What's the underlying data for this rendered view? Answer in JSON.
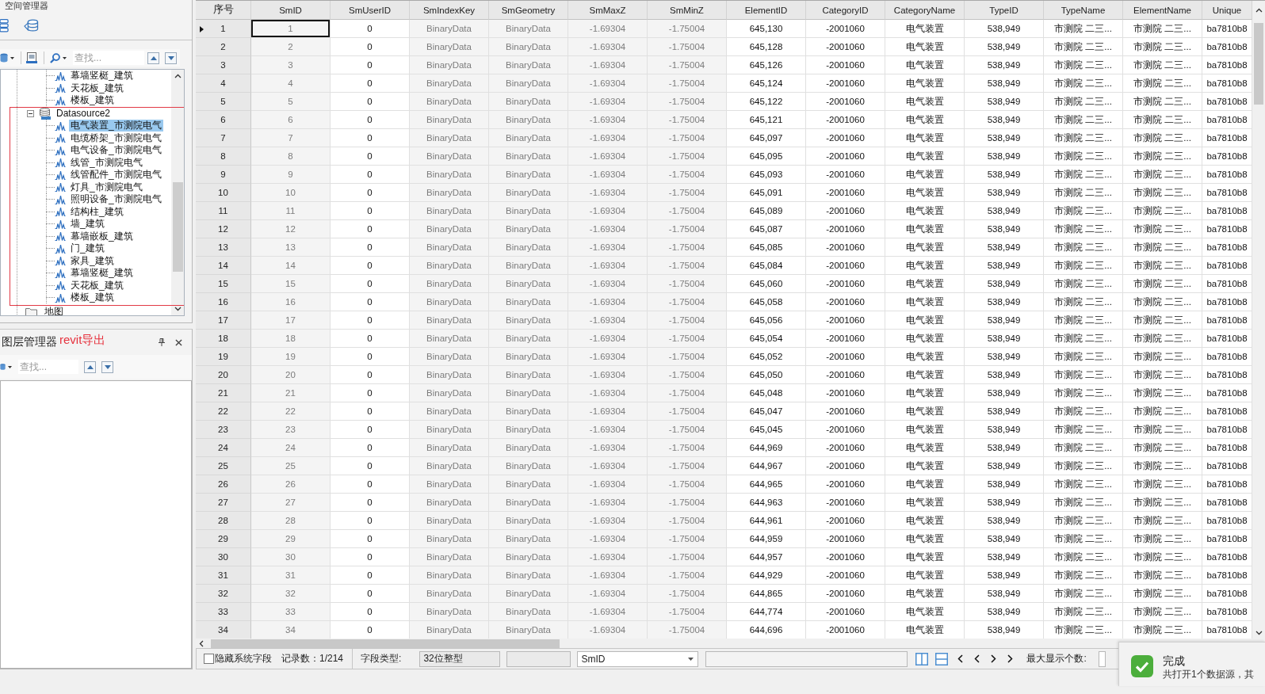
{
  "workspace_panel": {
    "title": "空间管理器",
    "search": {
      "placeholder": "查找..."
    },
    "tree": [
      {
        "label": "幕墙竖梃_建筑",
        "kind": "dataset",
        "selected": false
      },
      {
        "label": "天花板_建筑",
        "kind": "dataset",
        "selected": false
      },
      {
        "label": "楼板_建筑",
        "kind": "dataset",
        "selected": false
      },
      {
        "label": "Datasource2",
        "kind": "datasource",
        "expanded": true,
        "highlighted": true,
        "children": [
          {
            "label": "电气装置_市测院电气",
            "kind": "dataset",
            "selected": true
          },
          {
            "label": "电缆桥架_市测院电气",
            "kind": "dataset",
            "selected": false
          },
          {
            "label": "电气设备_市测院电气",
            "kind": "dataset",
            "selected": false
          },
          {
            "label": "线管_市测院电气",
            "kind": "dataset",
            "selected": false
          },
          {
            "label": "线管配件_市测院电气",
            "kind": "dataset",
            "selected": false
          },
          {
            "label": "灯具_市测院电气",
            "kind": "dataset",
            "selected": false
          },
          {
            "label": "照明设备_市测院电气",
            "kind": "dataset",
            "selected": false
          },
          {
            "label": "结构柱_建筑",
            "kind": "dataset",
            "selected": false
          },
          {
            "label": "墙_建筑",
            "kind": "dataset",
            "selected": false
          },
          {
            "label": "幕墙嵌板_建筑",
            "kind": "dataset",
            "selected": false
          },
          {
            "label": "门_建筑",
            "kind": "dataset",
            "selected": false
          },
          {
            "label": "家具_建筑",
            "kind": "dataset",
            "selected": false
          },
          {
            "label": "幕墙竖梃_建筑",
            "kind": "dataset",
            "selected": false
          },
          {
            "label": "天花板_建筑",
            "kind": "dataset",
            "selected": false
          },
          {
            "label": "楼板_建筑",
            "kind": "dataset",
            "selected": false
          }
        ]
      },
      {
        "label": "地图",
        "kind": "folder"
      }
    ]
  },
  "annotation": {
    "text": "revit导出"
  },
  "layer_panel": {
    "title": "图层管理器",
    "search": {
      "placeholder": "查找..."
    }
  },
  "table": {
    "row_number_heading": "序号",
    "columns": [
      {
        "label": "SmID",
        "readonly": true,
        "focused": true
      },
      {
        "label": "SmUserID",
        "readonly": false,
        "focused": false
      },
      {
        "label": "SmIndexKey",
        "readonly": true,
        "focused": false
      },
      {
        "label": "SmGeometry",
        "readonly": true,
        "focused": false
      },
      {
        "label": "SmMaxZ",
        "readonly": true,
        "focused": false
      },
      {
        "label": "SmMinZ",
        "readonly": true,
        "focused": false
      },
      {
        "label": "ElementID",
        "readonly": false,
        "focused": false
      },
      {
        "label": "CategoryID",
        "readonly": false,
        "focused": false
      },
      {
        "label": "CategoryName",
        "readonly": false,
        "focused": false
      },
      {
        "label": "TypeID",
        "readonly": false,
        "focused": false
      },
      {
        "label": "TypeName",
        "readonly": false,
        "focused": false
      },
      {
        "label": "ElementName",
        "readonly": false,
        "focused": false
      },
      {
        "label": "Unique",
        "readonly": false,
        "focused": false
      }
    ],
    "rows": [
      {
        "number": "1",
        "selected": true,
        "cells": [
          "1",
          "0",
          "BinaryData",
          "BinaryData",
          "-1.69304",
          "-1.75004",
          "645,130",
          "-2001060",
          "电气装置",
          "538,949",
          "市测院 二三...",
          "市测院 二三...",
          "ba7810b8"
        ]
      },
      {
        "number": "2",
        "selected": false,
        "cells": [
          "2",
          "0",
          "BinaryData",
          "BinaryData",
          "-1.69304",
          "-1.75004",
          "645,128",
          "-2001060",
          "电气装置",
          "538,949",
          "市测院 二三...",
          "市测院 二三...",
          "ba7810b8"
        ]
      },
      {
        "number": "3",
        "selected": false,
        "cells": [
          "3",
          "0",
          "BinaryData",
          "BinaryData",
          "-1.69304",
          "-1.75004",
          "645,126",
          "-2001060",
          "电气装置",
          "538,949",
          "市测院 二三...",
          "市测院 二三...",
          "ba7810b8"
        ]
      },
      {
        "number": "4",
        "selected": false,
        "cells": [
          "4",
          "0",
          "BinaryData",
          "BinaryData",
          "-1.69304",
          "-1.75004",
          "645,124",
          "-2001060",
          "电气装置",
          "538,949",
          "市测院 二三...",
          "市测院 二三...",
          "ba7810b8"
        ]
      },
      {
        "number": "5",
        "selected": false,
        "cells": [
          "5",
          "0",
          "BinaryData",
          "BinaryData",
          "-1.69304",
          "-1.75004",
          "645,122",
          "-2001060",
          "电气装置",
          "538,949",
          "市测院 二三...",
          "市测院 二三...",
          "ba7810b8"
        ]
      },
      {
        "number": "6",
        "selected": false,
        "cells": [
          "6",
          "0",
          "BinaryData",
          "BinaryData",
          "-1.69304",
          "-1.75004",
          "645,121",
          "-2001060",
          "电气装置",
          "538,949",
          "市测院 二三...",
          "市测院 二三...",
          "ba7810b8"
        ]
      },
      {
        "number": "7",
        "selected": false,
        "cells": [
          "7",
          "0",
          "BinaryData",
          "BinaryData",
          "-1.69304",
          "-1.75004",
          "645,097",
          "-2001060",
          "电气装置",
          "538,949",
          "市测院 二三...",
          "市测院 二三...",
          "ba7810b8"
        ]
      },
      {
        "number": "8",
        "selected": false,
        "cells": [
          "8",
          "0",
          "BinaryData",
          "BinaryData",
          "-1.69304",
          "-1.75004",
          "645,095",
          "-2001060",
          "电气装置",
          "538,949",
          "市测院 二三...",
          "市测院 二三...",
          "ba7810b8"
        ]
      },
      {
        "number": "9",
        "selected": false,
        "cells": [
          "9",
          "0",
          "BinaryData",
          "BinaryData",
          "-1.69304",
          "-1.75004",
          "645,093",
          "-2001060",
          "电气装置",
          "538,949",
          "市测院 二三...",
          "市测院 二三...",
          "ba7810b8"
        ]
      },
      {
        "number": "10",
        "selected": false,
        "cells": [
          "10",
          "0",
          "BinaryData",
          "BinaryData",
          "-1.69304",
          "-1.75004",
          "645,091",
          "-2001060",
          "电气装置",
          "538,949",
          "市测院 二三...",
          "市测院 二三...",
          "ba7810b8"
        ]
      },
      {
        "number": "11",
        "selected": false,
        "cells": [
          "11",
          "0",
          "BinaryData",
          "BinaryData",
          "-1.69304",
          "-1.75004",
          "645,089",
          "-2001060",
          "电气装置",
          "538,949",
          "市测院 二三...",
          "市测院 二三...",
          "ba7810b8"
        ]
      },
      {
        "number": "12",
        "selected": false,
        "cells": [
          "12",
          "0",
          "BinaryData",
          "BinaryData",
          "-1.69304",
          "-1.75004",
          "645,087",
          "-2001060",
          "电气装置",
          "538,949",
          "市测院 二三...",
          "市测院 二三...",
          "ba7810b8"
        ]
      },
      {
        "number": "13",
        "selected": false,
        "cells": [
          "13",
          "0",
          "BinaryData",
          "BinaryData",
          "-1.69304",
          "-1.75004",
          "645,085",
          "-2001060",
          "电气装置",
          "538,949",
          "市测院 二三...",
          "市测院 二三...",
          "ba7810b8"
        ]
      },
      {
        "number": "14",
        "selected": false,
        "cells": [
          "14",
          "0",
          "BinaryData",
          "BinaryData",
          "-1.69304",
          "-1.75004",
          "645,084",
          "-2001060",
          "电气装置",
          "538,949",
          "市测院 二三...",
          "市测院 二三...",
          "ba7810b8"
        ]
      },
      {
        "number": "15",
        "selected": false,
        "cells": [
          "15",
          "0",
          "BinaryData",
          "BinaryData",
          "-1.69304",
          "-1.75004",
          "645,060",
          "-2001060",
          "电气装置",
          "538,949",
          "市测院 二三...",
          "市测院 二三...",
          "ba7810b8"
        ]
      },
      {
        "number": "16",
        "selected": false,
        "cells": [
          "16",
          "0",
          "BinaryData",
          "BinaryData",
          "-1.69304",
          "-1.75004",
          "645,058",
          "-2001060",
          "电气装置",
          "538,949",
          "市测院 二三...",
          "市测院 二三...",
          "ba7810b8"
        ]
      },
      {
        "number": "17",
        "selected": false,
        "cells": [
          "17",
          "0",
          "BinaryData",
          "BinaryData",
          "-1.69304",
          "-1.75004",
          "645,056",
          "-2001060",
          "电气装置",
          "538,949",
          "市测院 二三...",
          "市测院 二三...",
          "ba7810b8"
        ]
      },
      {
        "number": "18",
        "selected": false,
        "cells": [
          "18",
          "0",
          "BinaryData",
          "BinaryData",
          "-1.69304",
          "-1.75004",
          "645,054",
          "-2001060",
          "电气装置",
          "538,949",
          "市测院 二三...",
          "市测院 二三...",
          "ba7810b8"
        ]
      },
      {
        "number": "19",
        "selected": false,
        "cells": [
          "19",
          "0",
          "BinaryData",
          "BinaryData",
          "-1.69304",
          "-1.75004",
          "645,052",
          "-2001060",
          "电气装置",
          "538,949",
          "市测院 二三...",
          "市测院 二三...",
          "ba7810b8"
        ]
      },
      {
        "number": "20",
        "selected": false,
        "cells": [
          "20",
          "0",
          "BinaryData",
          "BinaryData",
          "-1.69304",
          "-1.75004",
          "645,050",
          "-2001060",
          "电气装置",
          "538,949",
          "市测院 二三...",
          "市测院 二三...",
          "ba7810b8"
        ]
      },
      {
        "number": "21",
        "selected": false,
        "cells": [
          "21",
          "0",
          "BinaryData",
          "BinaryData",
          "-1.69304",
          "-1.75004",
          "645,048",
          "-2001060",
          "电气装置",
          "538,949",
          "市测院 二三...",
          "市测院 二三...",
          "ba7810b8"
        ]
      },
      {
        "number": "22",
        "selected": false,
        "cells": [
          "22",
          "0",
          "BinaryData",
          "BinaryData",
          "-1.69304",
          "-1.75004",
          "645,047",
          "-2001060",
          "电气装置",
          "538,949",
          "市测院 二三...",
          "市测院 二三...",
          "ba7810b8"
        ]
      },
      {
        "number": "23",
        "selected": false,
        "cells": [
          "23",
          "0",
          "BinaryData",
          "BinaryData",
          "-1.69304",
          "-1.75004",
          "645,045",
          "-2001060",
          "电气装置",
          "538,949",
          "市测院 二三...",
          "市测院 二三...",
          "ba7810b8"
        ]
      },
      {
        "number": "24",
        "selected": false,
        "cells": [
          "24",
          "0",
          "BinaryData",
          "BinaryData",
          "-1.69304",
          "-1.75004",
          "644,969",
          "-2001060",
          "电气装置",
          "538,949",
          "市测院 二三...",
          "市测院 二三...",
          "ba7810b8"
        ]
      },
      {
        "number": "25",
        "selected": false,
        "cells": [
          "25",
          "0",
          "BinaryData",
          "BinaryData",
          "-1.69304",
          "-1.75004",
          "644,967",
          "-2001060",
          "电气装置",
          "538,949",
          "市测院 二三...",
          "市测院 二三...",
          "ba7810b8"
        ]
      },
      {
        "number": "26",
        "selected": false,
        "cells": [
          "26",
          "0",
          "BinaryData",
          "BinaryData",
          "-1.69304",
          "-1.75004",
          "644,965",
          "-2001060",
          "电气装置",
          "538,949",
          "市测院 二三...",
          "市测院 二三...",
          "ba7810b8"
        ]
      },
      {
        "number": "27",
        "selected": false,
        "cells": [
          "27",
          "0",
          "BinaryData",
          "BinaryData",
          "-1.69304",
          "-1.75004",
          "644,963",
          "-2001060",
          "电气装置",
          "538,949",
          "市测院 二三...",
          "市测院 二三...",
          "ba7810b8"
        ]
      },
      {
        "number": "28",
        "selected": false,
        "cells": [
          "28",
          "0",
          "BinaryData",
          "BinaryData",
          "-1.69304",
          "-1.75004",
          "644,961",
          "-2001060",
          "电气装置",
          "538,949",
          "市测院 二三...",
          "市测院 二三...",
          "ba7810b8"
        ]
      },
      {
        "number": "29",
        "selected": false,
        "cells": [
          "29",
          "0",
          "BinaryData",
          "BinaryData",
          "-1.69304",
          "-1.75004",
          "644,959",
          "-2001060",
          "电气装置",
          "538,949",
          "市测院 二三...",
          "市测院 二三...",
          "ba7810b8"
        ]
      },
      {
        "number": "30",
        "selected": false,
        "cells": [
          "30",
          "0",
          "BinaryData",
          "BinaryData",
          "-1.69304",
          "-1.75004",
          "644,957",
          "-2001060",
          "电气装置",
          "538,949",
          "市测院 二三...",
          "市测院 二三...",
          "ba7810b8"
        ]
      },
      {
        "number": "31",
        "selected": false,
        "cells": [
          "31",
          "0",
          "BinaryData",
          "BinaryData",
          "-1.69304",
          "-1.75004",
          "644,929",
          "-2001060",
          "电气装置",
          "538,949",
          "市测院 二三...",
          "市测院 二三...",
          "ba7810b8"
        ]
      },
      {
        "number": "32",
        "selected": false,
        "cells": [
          "32",
          "0",
          "BinaryData",
          "BinaryData",
          "-1.69304",
          "-1.75004",
          "644,865",
          "-2001060",
          "电气装置",
          "538,949",
          "市测院 二三...",
          "市测院 二三...",
          "ba7810b8"
        ]
      },
      {
        "number": "33",
        "selected": false,
        "cells": [
          "33",
          "0",
          "BinaryData",
          "BinaryData",
          "-1.69304",
          "-1.75004",
          "644,774",
          "-2001060",
          "电气装置",
          "538,949",
          "市测院 二三...",
          "市测院 二三...",
          "ba7810b8"
        ]
      },
      {
        "number": "34",
        "selected": false,
        "cells": [
          "34",
          "0",
          "BinaryData",
          "BinaryData",
          "-1.69304",
          "-1.75004",
          "644,696",
          "-2001060",
          "电气装置",
          "538,949",
          "市测院 二三...",
          "市测院 二三...",
          "ba7810b8"
        ]
      }
    ]
  },
  "status_bar": {
    "hide_system_fields": {
      "label": "隐藏系统字段",
      "checked": false
    },
    "record_count": "记录数：1/214",
    "field_type_label": "字段类型:",
    "field_type": {
      "value": "32位整型"
    },
    "field_selector": {
      "value": "SmID"
    },
    "max_display_label": "最大显示个数:"
  },
  "notification": {
    "title": "完成",
    "message": "共打开1个数据源，其"
  }
}
